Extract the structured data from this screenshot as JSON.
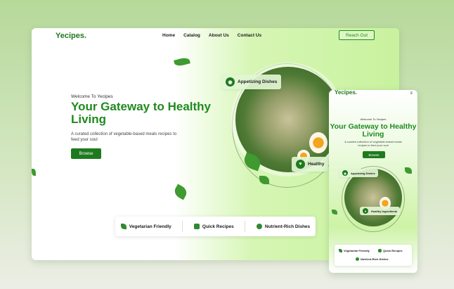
{
  "brand": {
    "logo": "Yecipes.",
    "accent": "#1f7a1f"
  },
  "nav": {
    "items": [
      "Home",
      "Catalog",
      "About Us",
      "Contact Us"
    ],
    "cta": "Reach Out"
  },
  "hero": {
    "welcome": "Welcome To Yecipes",
    "headline": "Your Gateway to Healthy Living",
    "subtitle": "A curated collection of vegetable-based meals recipes to feed your soul",
    "button": "Browse"
  },
  "badges": {
    "appetizing": "Appetizing Dishes",
    "healthy_desktop": "Healthy",
    "healthy_mobile": "Healthy Ingredients"
  },
  "features": [
    "Vegetarian Friendly",
    "Quick Recipes",
    "Nutrient-Rich Dishes"
  ],
  "mobile": {
    "logo": "Yecipes.",
    "menu_icon": "hamburger-icon"
  }
}
